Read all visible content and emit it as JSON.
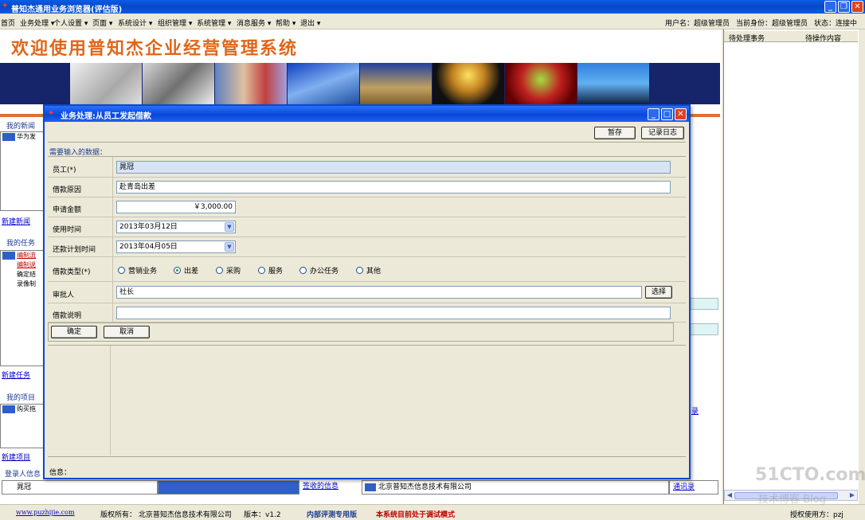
{
  "window": {
    "title": "普知杰通用业务浏览器(评估版)",
    "colors": {
      "titlebar": "#0a5ce6",
      "accent": "#e0661a",
      "link": "#0000cc"
    }
  },
  "menu": {
    "items": [
      "首页",
      "业务处理 ▾",
      "个人设置 ▾",
      "页面 ▾",
      "系统设计 ▾",
      "组织管理 ▾",
      "系统管理 ▾",
      "消息服务 ▾",
      "帮助 ▾",
      "退出 ▾"
    ]
  },
  "userinfo": {
    "user": "用户名：超级管理员",
    "role": "当前身份：超级管理员",
    "status": "状态：连接中"
  },
  "welcome": "欢迎使用普知杰企业经营管理系统",
  "sections": {
    "news_title": "我的新闻",
    "news_rows": [
      "华为发"
    ],
    "news_link": "新建新闻",
    "tasks_title": "我的任务",
    "task_rows": [
      "编制流",
      "编制说",
      "确定结",
      "录像制"
    ],
    "tasks_link": "新建任务",
    "projects_title": "我的项目",
    "project_rows": [
      "购买拖"
    ],
    "projects_link": "新建项目",
    "login_title": "登录人信息"
  },
  "bottom_strip": {
    "name": "晁冠",
    "sign_link": "签收的信息",
    "company": "北京普知杰信息技术有限公司",
    "contacts_link": "通讯录",
    "record_link": "录"
  },
  "right_panel": {
    "col1": "待处理事务",
    "col2": "待操作内容"
  },
  "footer": {
    "site": "www.puzhijie.com",
    "copyright": "版权所有： 北京普知杰信息技术有限公司",
    "version": "版本：v1.2",
    "internal": "内部评测专用版",
    "debug": "本系统目前处于调试模式",
    "authorized": "授权使用方：pzj"
  },
  "watermark": {
    "main": "51CTO.com",
    "sub": "技术博客 Blog"
  },
  "dialog": {
    "title": "业务处理:从员工发起借款",
    "save_label": "暂存",
    "log_label": "记录日志",
    "required_label": "需要输入的数据：",
    "fields": {
      "employee_label": "员工(*)",
      "employee_value": "晁冠",
      "reason_label": "借款原因",
      "reason_value": "赴青岛出差",
      "amount_label": "申请金额",
      "amount_value": "￥3,000.00",
      "use_date_label": "使用时间",
      "use_date_value": "2013年03月12日",
      "repay_date_label": "还款计划时间",
      "repay_date_value": "2013年04月05日",
      "type_label": "借款类型(*)",
      "type_options": [
        "营销业务",
        "出差",
        "采购",
        "服务",
        "办公任务",
        "其他"
      ],
      "type_selected": "出差",
      "approver_label": "审批人",
      "approver_value": "社长",
      "select_label": "选择",
      "note_label": "借款说明",
      "note_value": ""
    },
    "ok_label": "确定",
    "cancel_label": "取消",
    "info_label": "信息："
  }
}
